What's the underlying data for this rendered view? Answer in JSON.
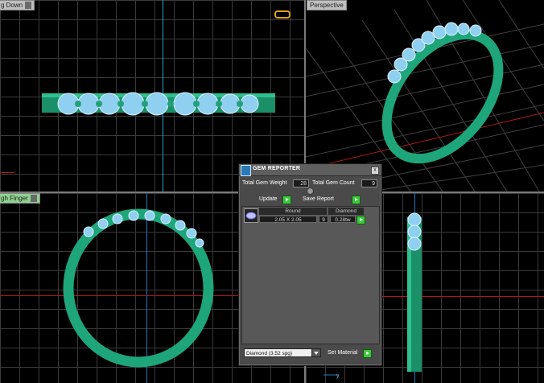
{
  "viewports": {
    "top_left_label": "g Down",
    "top_right_label": "Perspective",
    "bottom_left_label": "gh Finger"
  },
  "gem_reporter": {
    "title": "GEM REPORTER",
    "total_weight_label": "Total Gem Weight",
    "total_weight_value": "28",
    "total_count_label": "Total Gem Count",
    "total_count_value": "9",
    "update_label": "Update",
    "save_report_label": "Save Report",
    "table": {
      "headers": [
        "Round",
        "Diamond"
      ],
      "row": {
        "size": "2.05 X 2.05",
        "count": "9",
        "weight": "0.28tw"
      }
    },
    "material_select": "Diamond   (3.52 spg)",
    "set_material_label": "Set Material",
    "close_glyph": "x"
  },
  "axis_label_y": "y",
  "colors": {
    "ring_green": "#1ea57a",
    "gem_blue": "#8fd0f0",
    "grid": "#3a3a3a",
    "button_green": "#3cc83c"
  }
}
